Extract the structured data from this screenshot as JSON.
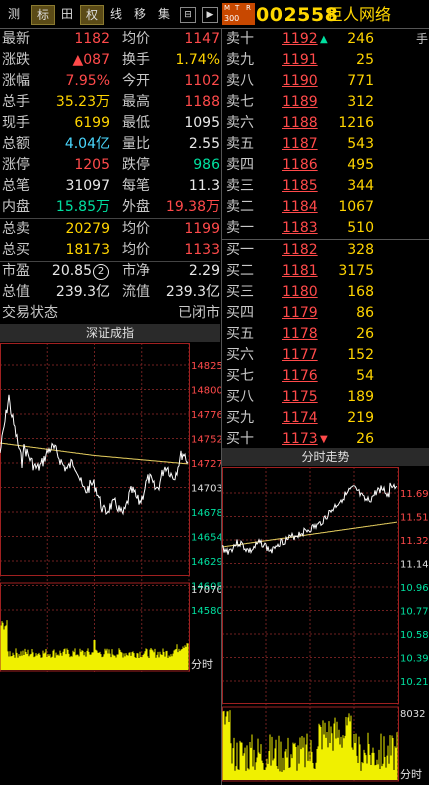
{
  "toolbar": {
    "buttons": [
      "测",
      "标",
      "田",
      "权",
      "线",
      "移",
      "集"
    ],
    "mtr": [
      "M",
      "T",
      "R",
      "300"
    ],
    "code": "002558",
    "name": "巨人网络",
    "cut_label": "手"
  },
  "quote": {
    "rows": [
      {
        "l1": "最新",
        "v1": "1182",
        "l2": "均价",
        "v2": "1147"
      },
      {
        "l1": "涨跌",
        "v1": "▲087",
        "l2": "换手",
        "v2": "1.74%"
      },
      {
        "l1": "涨幅",
        "v1": "7.95%",
        "l2": "今开",
        "v2": "1102"
      },
      {
        "l1": "总手",
        "v1": "35.23万",
        "l2": "最高",
        "v2": "1188"
      },
      {
        "l1": "现手",
        "v1": "6199",
        "l2": "最低",
        "v2": "1095"
      },
      {
        "l1": "总额",
        "v1": "4.04亿",
        "l2": "量比",
        "v2": "2.55"
      },
      {
        "l1": "涨停",
        "v1": "1205",
        "l2": "跌停",
        "v2": "986"
      },
      {
        "l1": "总笔",
        "v1": "31097",
        "l2": "每笔",
        "v2": "11.3"
      },
      {
        "l1": "内盘",
        "v1": "15.85万",
        "l2": "外盘",
        "v2": "19.38万"
      },
      {
        "l1": "总卖",
        "v1": "20279",
        "l2": "均价",
        "v2": "1199"
      },
      {
        "l1": "总买",
        "v1": "18173",
        "l2": "均价",
        "v2": "1133"
      },
      {
        "l1": "市盈",
        "v1": "20.85",
        "badge": "2",
        "l2": "市净",
        "v2": "2.29"
      },
      {
        "l1": "总值",
        "v1": "239.3亿",
        "l2": "流值",
        "v2": "239.3亿"
      },
      {
        "l1": "交易状态",
        "v1": "",
        "l2": "",
        "v2": "已闭市"
      }
    ]
  },
  "orderbook": [
    {
      "label": "卖十",
      "price": "1192",
      "qty": "246",
      "mark": "▲"
    },
    {
      "label": "卖九",
      "price": "1191",
      "qty": "25"
    },
    {
      "label": "卖八",
      "price": "1190",
      "qty": "771"
    },
    {
      "label": "卖七",
      "price": "1189",
      "qty": "312"
    },
    {
      "label": "卖六",
      "price": "1188",
      "qty": "1216"
    },
    {
      "label": "卖五",
      "price": "1187",
      "qty": "543"
    },
    {
      "label": "卖四",
      "price": "1186",
      "qty": "495"
    },
    {
      "label": "卖三",
      "price": "1185",
      "qty": "344"
    },
    {
      "label": "卖二",
      "price": "1184",
      "qty": "1067"
    },
    {
      "label": "卖一",
      "price": "1183",
      "qty": "510"
    },
    {
      "label": "买一",
      "price": "1182",
      "qty": "328"
    },
    {
      "label": "买二",
      "price": "1181",
      "qty": "3175"
    },
    {
      "label": "买三",
      "price": "1180",
      "qty": "168"
    },
    {
      "label": "买四",
      "price": "1179",
      "qty": "86"
    },
    {
      "label": "买五",
      "price": "1178",
      "qty": "26"
    },
    {
      "label": "买六",
      "price": "1177",
      "qty": "152"
    },
    {
      "label": "买七",
      "price": "1176",
      "qty": "54"
    },
    {
      "label": "买八",
      "price": "1175",
      "qty": "189"
    },
    {
      "label": "买九",
      "price": "1174",
      "qty": "219"
    },
    {
      "label": "买十",
      "price": "1173",
      "qty": "26",
      "mark": "▼"
    }
  ],
  "index_chart": {
    "title": "深证成指",
    "ticks": [
      "14825",
      "14800",
      "14776",
      "14752",
      "14727",
      "14703",
      "14678",
      "14654",
      "14629",
      "14605",
      "14580"
    ],
    "vol_top": "17070",
    "vol_label": "分时"
  },
  "stock_chart": {
    "title": "分时走势",
    "ticks": [
      "11.69",
      "11.51",
      "11.32",
      "11.14",
      "10.96",
      "10.77",
      "10.58",
      "10.39",
      "10.21"
    ],
    "vol_top": "8032",
    "vol_label": "分时"
  },
  "colors": {
    "up": "#ff4a4a",
    "down": "#00e0a0",
    "price_line": "#ffffff",
    "avg_line": "#e8d060",
    "volume": "#f0f000"
  }
}
